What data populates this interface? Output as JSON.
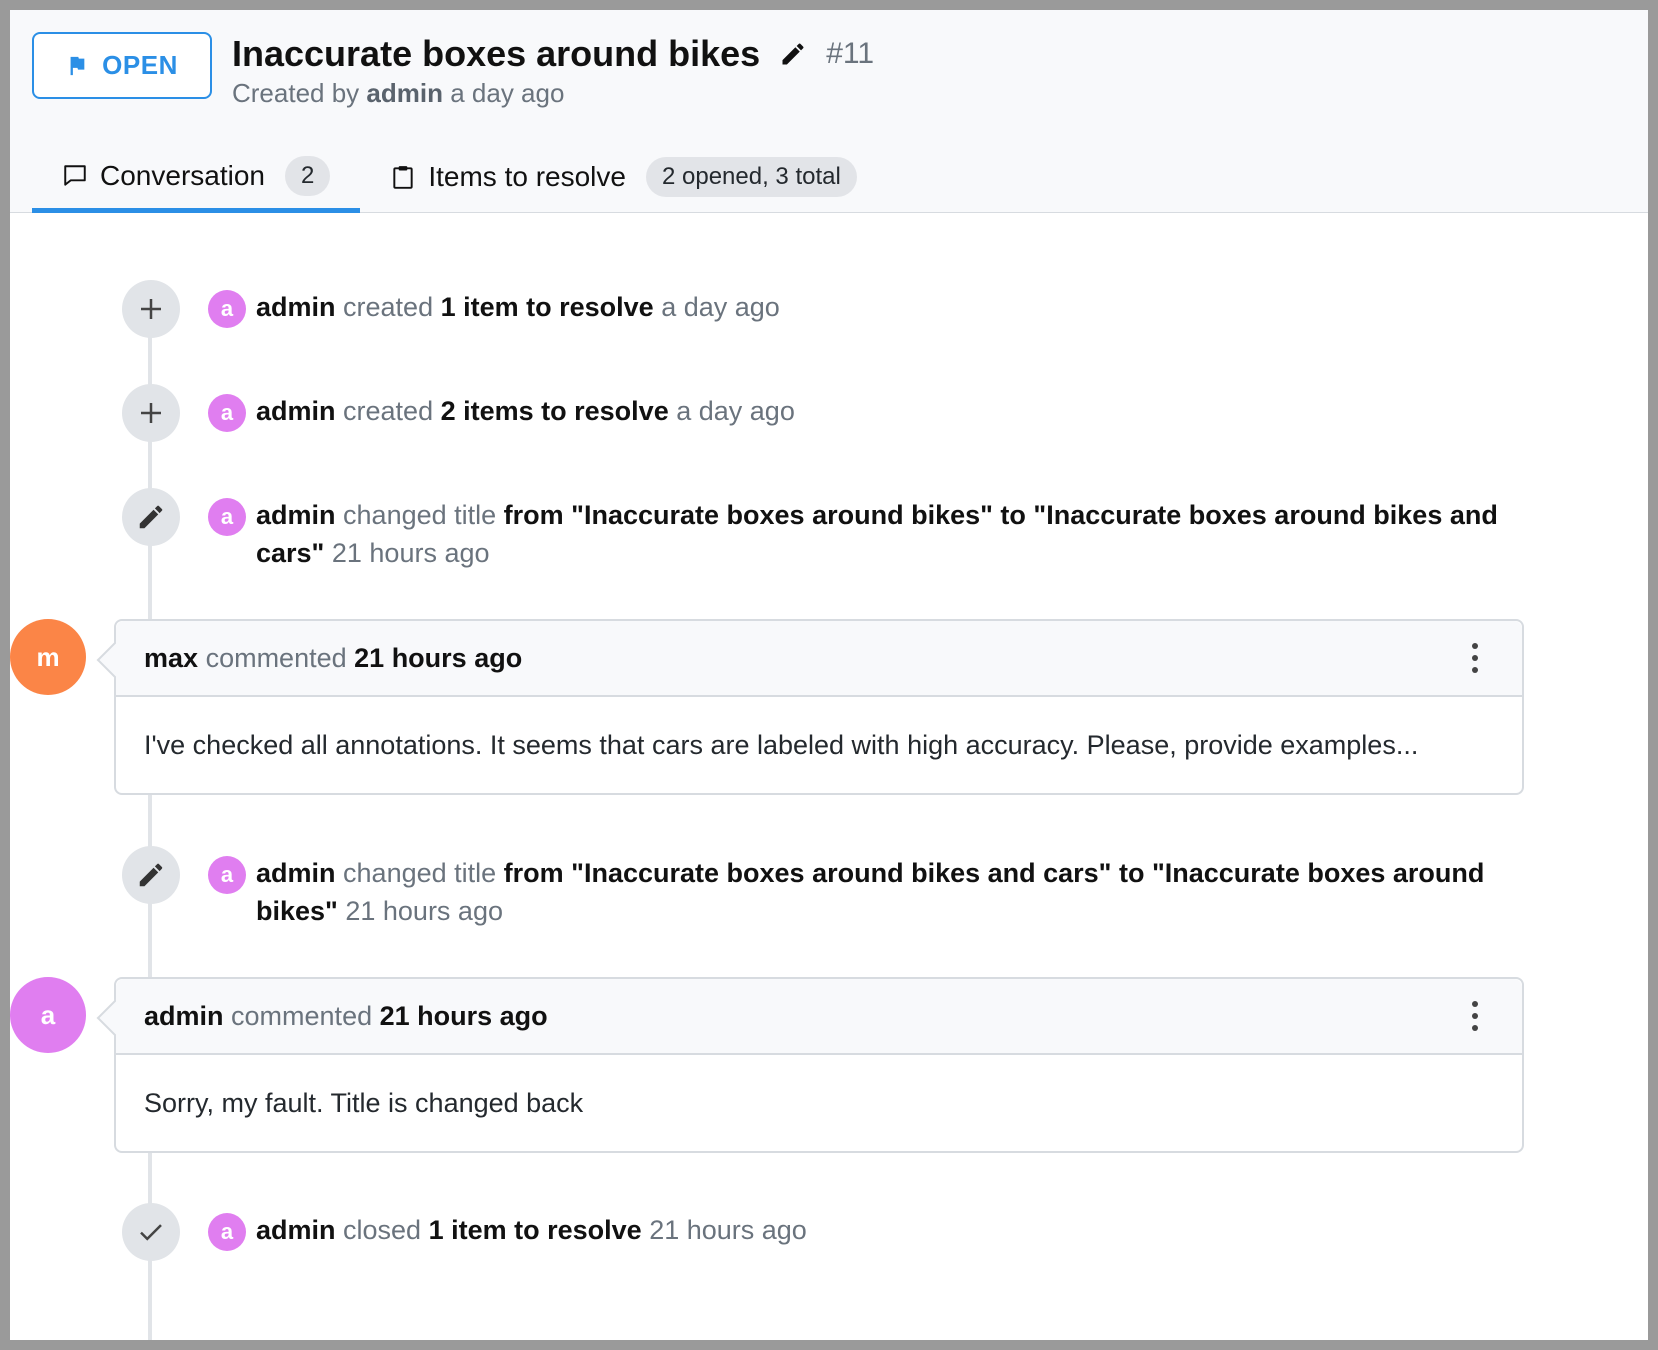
{
  "header": {
    "status_label": "OPEN",
    "title": "Inaccurate boxes around bikes",
    "issue_number": "#11",
    "created_prefix": "Created by",
    "created_by": "admin",
    "created_when": "a day ago"
  },
  "tabs": [
    {
      "label": "Conversation",
      "count": "2"
    },
    {
      "label": "Items to resolve",
      "count": "2 opened, 3 total"
    }
  ],
  "events": [
    {
      "icon": "plus-icon",
      "avatar": "a",
      "user": "admin",
      "action": "created",
      "detail": "1 item to resolve",
      "time": "a day ago"
    },
    {
      "icon": "plus-icon",
      "avatar": "a",
      "user": "admin",
      "action": "created",
      "detail": "2 items to resolve",
      "time": "a day ago"
    },
    {
      "icon": "pencil-icon",
      "avatar": "a",
      "user": "admin",
      "action": "changed title",
      "detail": "from \"Inaccurate boxes around bikes\" to \"Inaccurate boxes around bikes and cars\"",
      "time": "21 hours ago"
    },
    {
      "icon": "pencil-icon",
      "avatar": "a",
      "user": "admin",
      "action": "changed title",
      "detail": "from \"Inaccurate boxes around bikes and cars\" to \"Inaccurate boxes around bikes\"",
      "time": "21 hours ago"
    },
    {
      "icon": "check-icon",
      "avatar": "a",
      "user": "admin",
      "action": "closed",
      "detail": "1 item to resolve",
      "time": "21 hours ago"
    }
  ],
  "comments": [
    {
      "avatar": "m",
      "avatar_color": "#fb8547",
      "user": "max",
      "action": "commented",
      "time": "21 hours ago",
      "body": "I've checked all annotations. It seems that cars are labeled with high accuracy. Please, provide examples..."
    },
    {
      "avatar": "a",
      "avatar_color": "#e07ef0",
      "user": "admin",
      "action": "commented",
      "time": "21 hours ago",
      "body": "Sorry, my fault. Title is changed back"
    }
  ],
  "colors": {
    "accent": "#2b8fe6",
    "admin_avatar": "#e07ef0",
    "max_avatar": "#fb8547"
  }
}
